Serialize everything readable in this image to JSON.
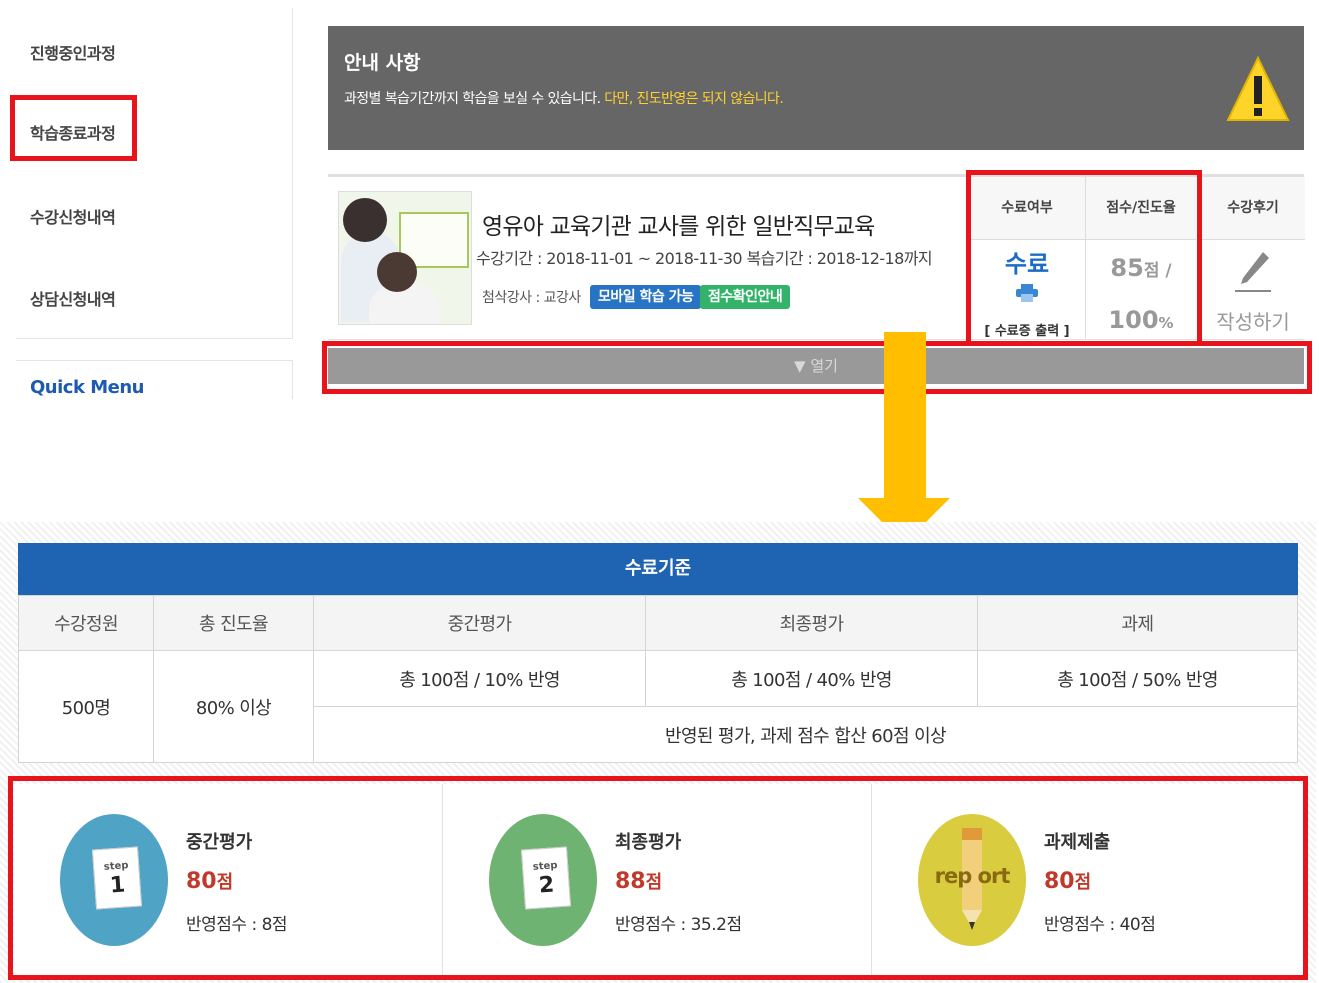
{
  "sidebar": {
    "items": [
      {
        "label": "진행중인과정"
      },
      {
        "label": "학습종료과정"
      },
      {
        "label": "수강신청내역"
      },
      {
        "label": "상담신청내역"
      }
    ],
    "quick_menu": "Quick Menu"
  },
  "notice": {
    "title": "안내 사항",
    "text": "과정별 복습기간까지 학습을 보실 수 있습니다.",
    "highlight": "다만, 진도반영은 되지 않습니다.",
    "icon": "warning-icon"
  },
  "course": {
    "title": "영유아 교육기관 교사를 위한 일반직무교육",
    "period": "수강기간 : 2018-11-01 ~ 2018-11-30   복습기간 : 2018-12-18까지",
    "instructor": "첨삭강사 : 교강사",
    "badge_mobile": "모바일 학습 가능",
    "badge_score": "점수확인안내",
    "columns": {
      "completion": "수료여부",
      "score_progress": "점수/진도율",
      "review": "수강후기"
    },
    "completion_value": "수료",
    "certificate_label": "[ 수료증 출력 ]",
    "score_value": "85",
    "score_unit": "점",
    "score_sep": " /",
    "progress_value": "100",
    "progress_unit": "%",
    "review_label": "작성하기",
    "open_label": "▼ 열기"
  },
  "criteria": {
    "title": "수료기준",
    "headers": [
      "수강정원",
      "총 진도율",
      "중간평가",
      "최종평가",
      "과제"
    ],
    "capacity": "500명",
    "progress_req": "80% 이상",
    "midterm": "총 100점 / 10% 반영",
    "final": "총 100점 / 40% 반영",
    "assignment": "총 100점 / 50% 반영",
    "total_rule": "반영된 평가, 과제 점수 합산 60점 이상"
  },
  "steps": [
    {
      "title": "중간평가",
      "score": "80",
      "unit": "점",
      "reflected": "반영점수 : 8점",
      "step_label": "step",
      "step_num": "1",
      "color": "#4fa3c4"
    },
    {
      "title": "최종평가",
      "score": "88",
      "unit": "점",
      "reflected": "반영점수 : 35.2점",
      "step_label": "step",
      "step_num": "2",
      "color": "#6fb373"
    },
    {
      "title": "과제제출",
      "score": "80",
      "unit": "점",
      "reflected": "반영점수 : 40점",
      "report_label": "rep   ort",
      "color": "#d9cc3e"
    }
  ],
  "colors": {
    "highlight_red": "#e8141c",
    "arrow": "#ffbf00",
    "header_blue": "#1f64b3"
  }
}
